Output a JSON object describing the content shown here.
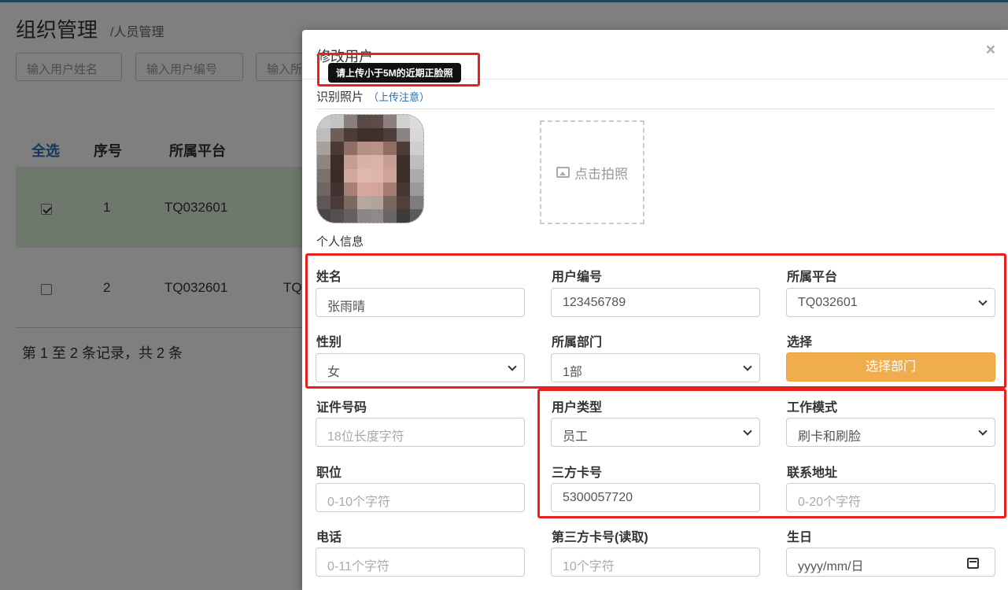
{
  "page": {
    "title": "组织管理",
    "subtitle": "/人员管理"
  },
  "filters": [
    {
      "placeholder": "输入用户姓名"
    },
    {
      "placeholder": "输入用户编号"
    },
    {
      "placeholder": "输入所"
    }
  ],
  "table": {
    "headers": [
      "全选",
      "序号",
      "所属平台"
    ],
    "rows": [
      {
        "index": "1",
        "platform": "TQ032601",
        "extra": "",
        "checked": true
      },
      {
        "index": "2",
        "platform": "TQ032601",
        "extra": "TQ",
        "checked": false
      }
    ],
    "footer": "第 1 至 2 条记录，共 2 条"
  },
  "modal": {
    "title": "修改用户",
    "close": "×",
    "tooltip": "请上传小于5M的近期正脸照",
    "photo_section": {
      "label": "识别照片",
      "note": "（上传注意）"
    },
    "camera_label": "点击拍照",
    "info_section": "个人信息",
    "fields": {
      "name": {
        "label": "姓名",
        "value": "张雨晴"
      },
      "user_no": {
        "label": "用户编号",
        "value": "123456789"
      },
      "platform": {
        "label": "所属平台",
        "value": "TQ032601"
      },
      "gender": {
        "label": "性别",
        "value": "女"
      },
      "dept": {
        "label": "所属部门",
        "value": "1部"
      },
      "choose": {
        "label": "选择",
        "button": "选择部门"
      },
      "id_no": {
        "label": "证件号码",
        "placeholder": "18位长度字符"
      },
      "user_type": {
        "label": "用户类型",
        "value": "员工"
      },
      "work_mode": {
        "label": "工作模式",
        "value": "刷卡和刷脸"
      },
      "position": {
        "label": "职位",
        "placeholder": "0-10个字符"
      },
      "third_card": {
        "label": "三方卡号",
        "value": "5300057720"
      },
      "address": {
        "label": "联系地址",
        "placeholder": "0-20个字符"
      },
      "phone": {
        "label": "电话",
        "placeholder": "0-11个字符"
      },
      "third_card_read": {
        "label": "第三方卡号(读取)",
        "placeholder": "10个字符"
      },
      "birthday": {
        "label": "生日",
        "placeholder": "yyyy/mm/日"
      }
    }
  },
  "colors": {
    "accent": "#f0ad4e",
    "link": "#2a6fb4",
    "highlight": "#e8211f",
    "selected_row": "#dff0d8"
  }
}
